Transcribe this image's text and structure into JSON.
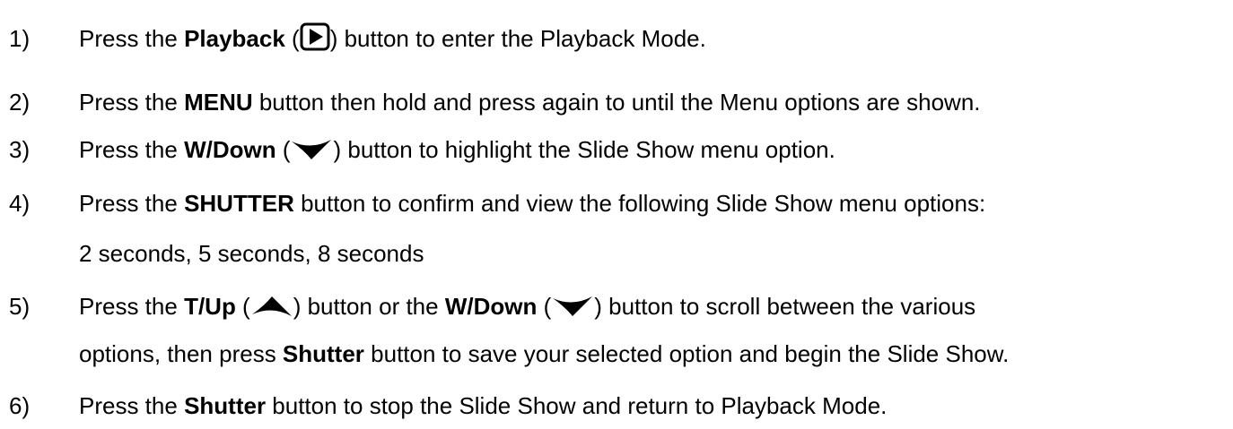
{
  "steps": [
    {
      "number": "1)",
      "parts": [
        {
          "t": "Press the "
        },
        {
          "b": "Playback"
        },
        {
          "t": " ("
        },
        {
          "icon": "play-icon"
        },
        {
          "t": ") button to enter the Playback Mode."
        }
      ]
    },
    {
      "number": "2)",
      "parts": [
        {
          "t": "Press the "
        },
        {
          "b": "MENU"
        },
        {
          "t": " button then hold and press again to until the Menu options are shown."
        }
      ]
    },
    {
      "number": "3)",
      "parts": [
        {
          "t": "Press the "
        },
        {
          "b": "W/Down"
        },
        {
          "t": " ("
        },
        {
          "icon": "down-chevron-icon"
        },
        {
          "t": ") button to highlight the Slide Show menu option."
        }
      ]
    },
    {
      "number": "4)",
      "parts": [
        {
          "t": "Press the "
        },
        {
          "b": "SHUTTER"
        },
        {
          "t": " button to confirm and view the following Slide Show menu options:"
        }
      ],
      "continuation": "2 seconds, 5 seconds, 8 seconds"
    },
    {
      "number": "5)",
      "parts": [
        {
          "t": "Press the "
        },
        {
          "b": "T/Up"
        },
        {
          "t": " ("
        },
        {
          "icon": "up-chevron-icon"
        },
        {
          "t": ") button or the "
        },
        {
          "b": "W/Down"
        },
        {
          "t": " ("
        },
        {
          "icon": "down-chevron-icon"
        },
        {
          "t": ") button to scroll between the various"
        }
      ],
      "continuation_parts": [
        {
          "t": "options, then press "
        },
        {
          "b": "Shutter"
        },
        {
          "t": " button to save your selected option and begin the Slide Show."
        }
      ]
    },
    {
      "number": "6)",
      "parts": [
        {
          "t": "Press the "
        },
        {
          "b": "Shutter"
        },
        {
          "t": " button to stop the Slide Show and return to Playback Mode."
        }
      ]
    }
  ]
}
